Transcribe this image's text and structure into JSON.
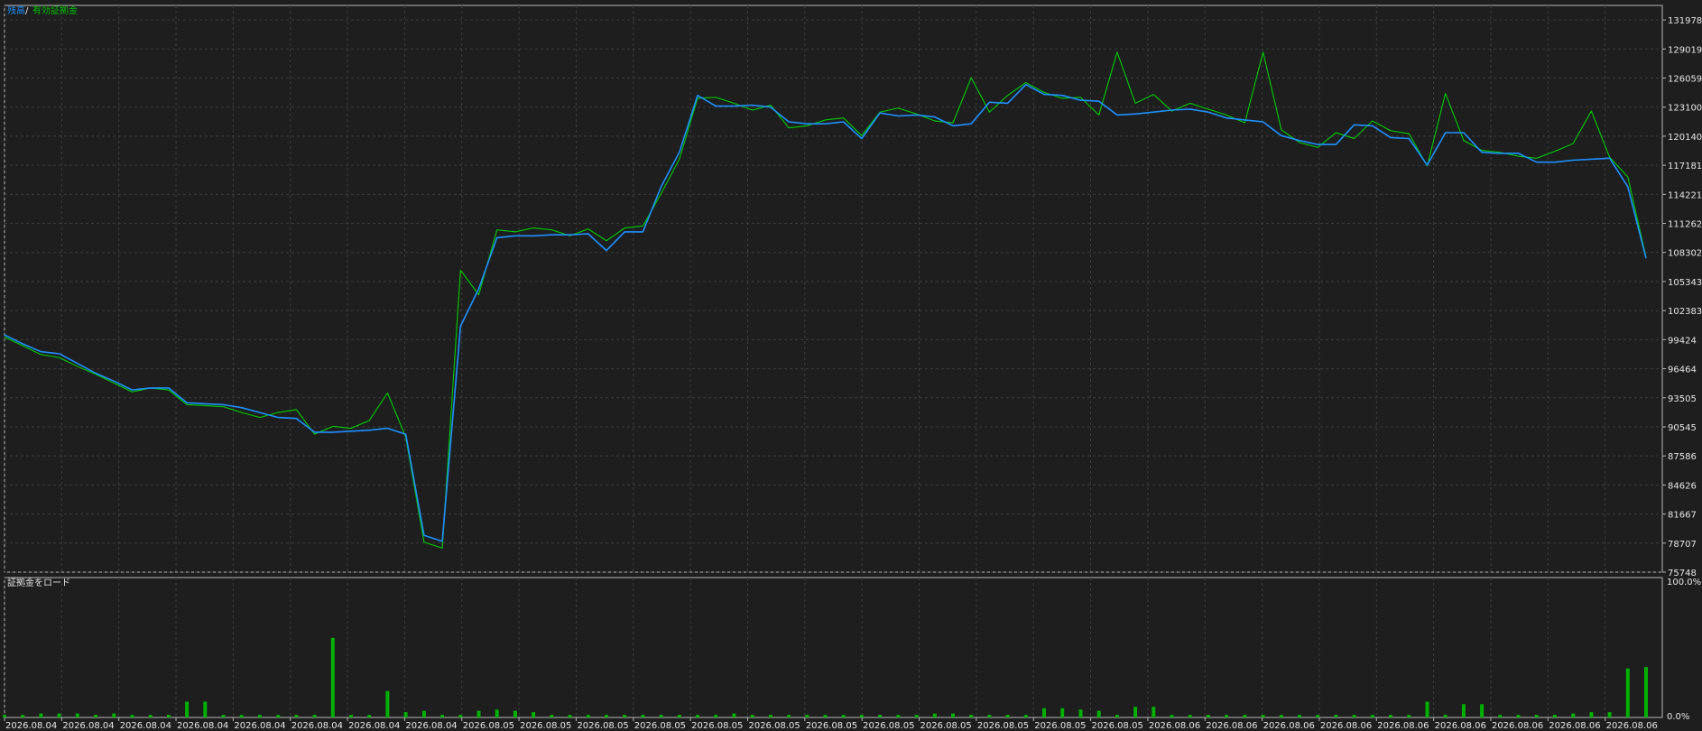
{
  "colors": {
    "background": "#1e1e1e",
    "frame": "#b8b8b8",
    "grid": "#3c3c3c",
    "balance": "#1e90ff",
    "equity": "#00c000",
    "load_bar": "#00b000",
    "text": "#e6e6e6"
  },
  "legend": {
    "balance_label": "残高",
    "separator": "/",
    "equity_label": "有効証拠金"
  },
  "subpanel": {
    "title": "証拠金をロード"
  },
  "chart_data": [
    {
      "type": "line",
      "grid": true,
      "y_ticks": [
        75748,
        78707,
        81667,
        84626,
        87586,
        90545,
        93505,
        96464,
        99424,
        102383,
        105343,
        108302,
        111262,
        114221,
        117181,
        120140,
        123100,
        126059,
        129019,
        131978
      ],
      "ylim": [
        75748,
        133458
      ],
      "x_ticks": [
        "2026.08.04",
        "2026.08.04",
        "2026.08.04",
        "2026.08.04",
        "2026.08.04",
        "2026.08.04",
        "2026.08.04",
        "2026.08.04",
        "2026.08.05",
        "2026.08.05",
        "2026.08.05",
        "2026.08.05",
        "2026.08.05",
        "2026.08.05",
        "2026.08.05",
        "2026.08.05",
        "2026.08.05",
        "2026.08.05",
        "2026.08.05",
        "2026.08.05",
        "2026.08.06",
        "2026.08.06",
        "2026.08.06",
        "2026.08.06",
        "2026.08.06",
        "2026.08.06",
        "2026.08.06",
        "2026.08.06",
        "2026.08.06"
      ],
      "series": [
        {
          "name": "残高",
          "values": [
            99900,
            99000,
            98200,
            98000,
            97000,
            96000,
            95200,
            94300,
            94500,
            94500,
            93000,
            92900,
            92800,
            92500,
            92000,
            91500,
            91400,
            90000,
            90000,
            90100,
            90200,
            90400,
            89800,
            79500,
            78900,
            100800,
            104600,
            109800,
            110000,
            110000,
            110100,
            110100,
            110200,
            108500,
            110400,
            110400,
            115000,
            118500,
            124300,
            123200,
            123200,
            123300,
            123100,
            121600,
            121400,
            121400,
            121600,
            119900,
            122500,
            122200,
            122300,
            122100,
            121200,
            121400,
            123600,
            123500,
            125400,
            124400,
            124300,
            123800,
            123700,
            122300,
            122400,
            122600,
            122800,
            122900,
            122600,
            122000,
            121800,
            121600,
            120200,
            119700,
            119300,
            119300,
            121300,
            121200,
            120000,
            119900,
            117200,
            120500,
            120500,
            118500,
            118400,
            118400,
            117500,
            117500,
            117700,
            117800,
            117900,
            115000,
            107700
          ]
        },
        {
          "name": "有効証拠金",
          "values": [
            99700,
            98800,
            97900,
            97600,
            96700,
            95900,
            95000,
            94100,
            94500,
            94300,
            92800,
            92700,
            92600,
            92000,
            91500,
            92000,
            92300,
            89800,
            90600,
            90400,
            91200,
            94000,
            89500,
            78800,
            78200,
            106500,
            104000,
            110600,
            110400,
            110800,
            110600,
            110000,
            110700,
            109500,
            110800,
            111000,
            114300,
            117800,
            124000,
            124100,
            123500,
            122800,
            123300,
            121000,
            121200,
            121800,
            122000,
            120200,
            122600,
            123000,
            122400,
            121700,
            121500,
            126100,
            122600,
            124300,
            125600,
            124600,
            124000,
            124100,
            122300,
            128700,
            123500,
            124400,
            122700,
            123500,
            122900,
            122300,
            121500,
            128700,
            120800,
            119500,
            119000,
            120500,
            119900,
            121700,
            120700,
            120400,
            117100,
            124500,
            119700,
            118700,
            118500,
            118100,
            117900,
            118600,
            119400,
            122700,
            118000,
            116000,
            107800
          ]
        }
      ],
      "load_bars": [
        2,
        2,
        3,
        3,
        3,
        2,
        3,
        2,
        2,
        2,
        12,
        12,
        2,
        2,
        2,
        2,
        2,
        2,
        60,
        2,
        2,
        20,
        4,
        5,
        2,
        2,
        5,
        6,
        5,
        4,
        2,
        2,
        2,
        2,
        2,
        2,
        2,
        2,
        2,
        2,
        3,
        2,
        2,
        2,
        2,
        2,
        2,
        2,
        2,
        2,
        2,
        3,
        3,
        2,
        2,
        2,
        2,
        7,
        7,
        6,
        5,
        2,
        8,
        8,
        2,
        2,
        2,
        2,
        2,
        2,
        2,
        2,
        2,
        2,
        2,
        2,
        2,
        2,
        12,
        2,
        10,
        10,
        2,
        2,
        2,
        2,
        3,
        4,
        4,
        37,
        38
      ]
    }
  ]
}
